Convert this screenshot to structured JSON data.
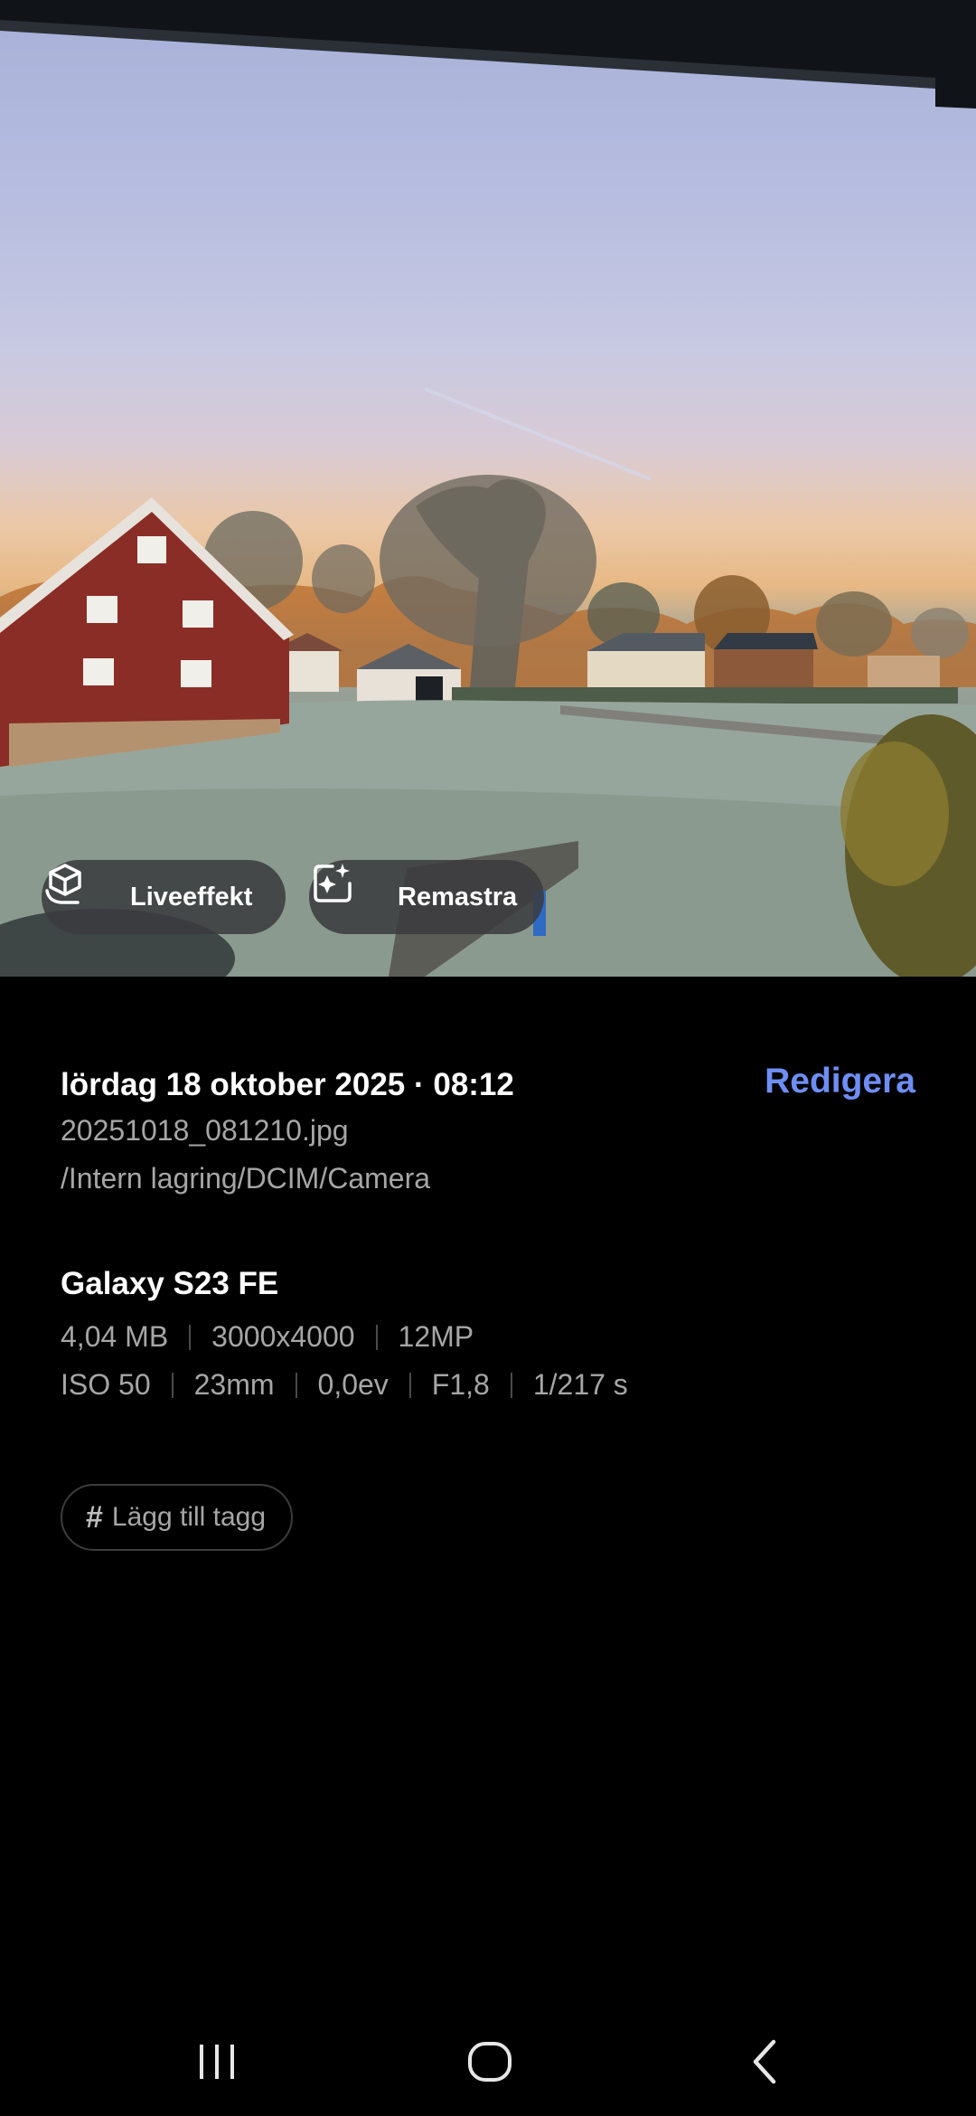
{
  "photo": {
    "actions": {
      "live_effect": {
        "label": "Liveeffekt",
        "icon": "cube-hand-icon"
      },
      "remaster": {
        "label": "Remastra",
        "icon": "sparkle-frame-icon"
      }
    }
  },
  "details": {
    "date_time": "lördag 18 oktober 2025 · 08:12",
    "edit_label": "Redigera",
    "filename": "20251018_081210.jpg",
    "path": "/Intern lagring/DCIM/Camera",
    "device": "Galaxy S23 FE",
    "specs_row1": [
      "4,04 MB",
      "3000x4000",
      "12MP"
    ],
    "specs_row2": [
      "ISO 50",
      "23mm",
      "0,0ev",
      "F1,8",
      "1/217 s"
    ],
    "tag_hash": "#",
    "tag_label": "Lägg till tagg"
  },
  "navbar": {
    "recents_icon": "recents-icon",
    "home_icon": "home-icon",
    "back_icon": "back-icon"
  },
  "colors": {
    "background": "#000000",
    "accent": "#6e8ef5",
    "secondary_text": "#a6a6a6"
  }
}
